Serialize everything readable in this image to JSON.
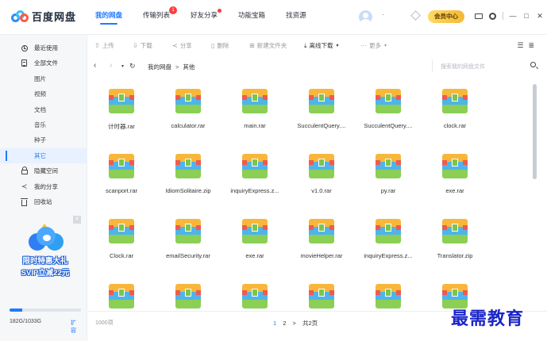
{
  "app": {
    "title": "百度网盘"
  },
  "topnav": [
    {
      "label": "我的网盘",
      "active": true
    },
    {
      "label": "传输列表",
      "badge": "1"
    },
    {
      "label": "好友分享",
      "dot": true
    },
    {
      "label": "功能宝箱"
    },
    {
      "label": "找资源"
    }
  ],
  "user": {
    "name": "·",
    "vip_label": "会员中心"
  },
  "window_controls": [
    "—",
    "□",
    "✕"
  ],
  "sidebar": {
    "items": [
      {
        "label": "最近使用",
        "icon": "clock-icon"
      },
      {
        "label": "全部文件",
        "icon": "document-icon"
      },
      {
        "label": "图片",
        "sub": true
      },
      {
        "label": "视频",
        "sub": true
      },
      {
        "label": "文档",
        "sub": true
      },
      {
        "label": "音乐",
        "sub": true
      },
      {
        "label": "种子",
        "sub": true
      },
      {
        "label": "其它",
        "sub": true,
        "active": true
      },
      {
        "label": "隐藏空间",
        "icon": "lock-icon"
      },
      {
        "label": "我的分享",
        "icon": "share-icon"
      },
      {
        "label": "回收站",
        "icon": "trash-icon"
      }
    ],
    "promo": {
      "line1": "限时特惠大礼",
      "line2": "SVIP立减22元",
      "close": "✕"
    },
    "storage": {
      "text": "182G/1033G",
      "link": "扩容",
      "used_fraction": 0.176
    }
  },
  "toolbar": {
    "upload": "上传",
    "download": "下载",
    "share": "分享",
    "delete": "删除",
    "new_folder": "新建文件夹",
    "offline_download": "离线下载",
    "more": "更多"
  },
  "addressbar": {
    "path": [
      "我的网盘",
      "其他"
    ],
    "search_placeholder": "搜索我的网盘文件"
  },
  "files": [
    "计时器.rar",
    "calculator.rar",
    "main.rar",
    "SucculentQuery....",
    "SucculentQuery....",
    "clock.rar",
    "scanport.rar",
    "IdiomSolitaire.zip",
    "inquiryExpress.z...",
    "v1.0.rar",
    "py.rar",
    "exe.rar",
    "Clock.rar",
    "emailSecurity.rar",
    "exe.rar",
    "movieHelper.rar",
    "inquiryExpress.z...",
    "Translator.zip",
    "",
    "",
    "",
    "",
    "",
    ""
  ],
  "status": {
    "count": "1000项",
    "page1": "1",
    "page2": "2",
    "next": ">",
    "total": "共2页"
  },
  "watermark": "最需教育",
  "colors": {
    "accent": "#1f7aff",
    "vip": "#f5b834",
    "badge": "#ff3b3b"
  }
}
